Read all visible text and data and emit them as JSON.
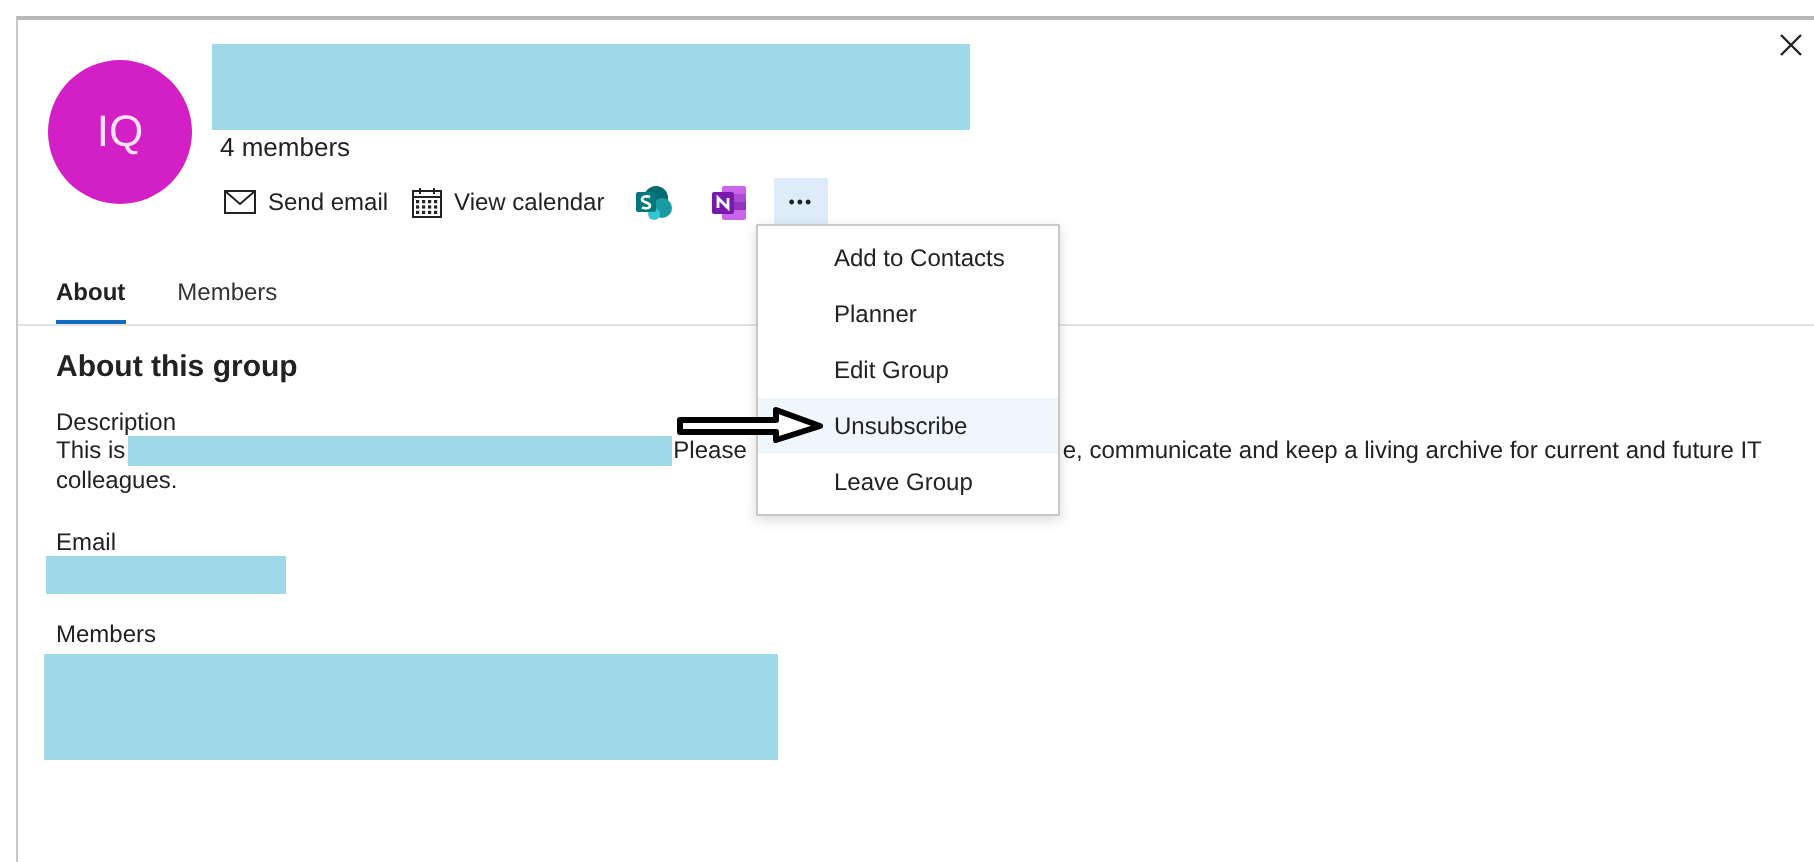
{
  "group": {
    "avatar_initials": "IQ",
    "member_count": "4 members"
  },
  "actions": [
    {
      "kind": "email",
      "label": "Send email",
      "selected": false
    },
    {
      "kind": "calendar",
      "label": "View calendar",
      "selected": false
    },
    {
      "kind": "sharepoint",
      "selected": false
    },
    {
      "kind": "onenote",
      "selected": false
    },
    {
      "kind": "more",
      "label": "•••",
      "selected": true
    }
  ],
  "tabs": [
    {
      "label": "About",
      "selected": true
    },
    {
      "label": "Members",
      "selected": false
    }
  ],
  "menu": {
    "items": [
      {
        "label": "Add to Contacts",
        "selected": false
      },
      {
        "label": "Planner",
        "selected": false
      },
      {
        "label": "Edit Group",
        "selected": false
      },
      {
        "label": "Unsubscribe",
        "selected": true
      },
      {
        "label": "Leave Group",
        "selected": false
      }
    ]
  },
  "about": {
    "heading": "About this group",
    "description_label": "Description",
    "description_before": "This is",
    "description_after": "Please",
    "description_after_menu": "e, communicate and keep a living archive for current and future IT",
    "description_next_line": "colleagues.",
    "email_label": "Email",
    "members_label": "Members"
  }
}
